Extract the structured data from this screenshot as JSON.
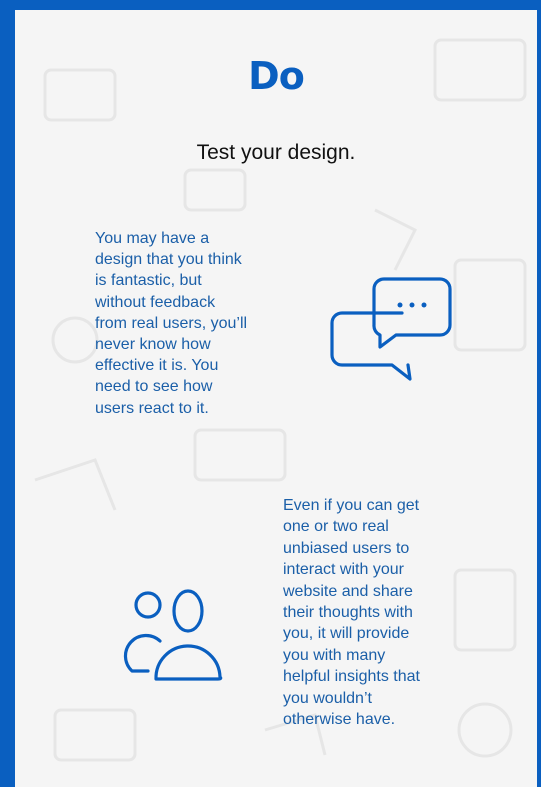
{
  "heading": "Do",
  "subheading": "Test your design.",
  "paragraph1": [
    "You may have a",
    "design that you think",
    "is fantastic, but",
    "without feedback",
    "from real users, you’ll",
    "never know how",
    "effective it is. You",
    "need to see how",
    "users react to it."
  ],
  "paragraph2": [
    "Even if you can get",
    "one or two real",
    "unbiased users to",
    "interact with your",
    "website and share",
    "their thoughts with",
    "you, it will provide",
    "you with many",
    "helpful insights that",
    "you wouldn’t",
    "otherwise have."
  ],
  "icons": {
    "chat": "chat-bubbles-icon",
    "users": "users-icon"
  },
  "colors": {
    "accent": "#0a5fc0",
    "body_text": "#1b5fa8",
    "background": "#f5f5f5"
  }
}
